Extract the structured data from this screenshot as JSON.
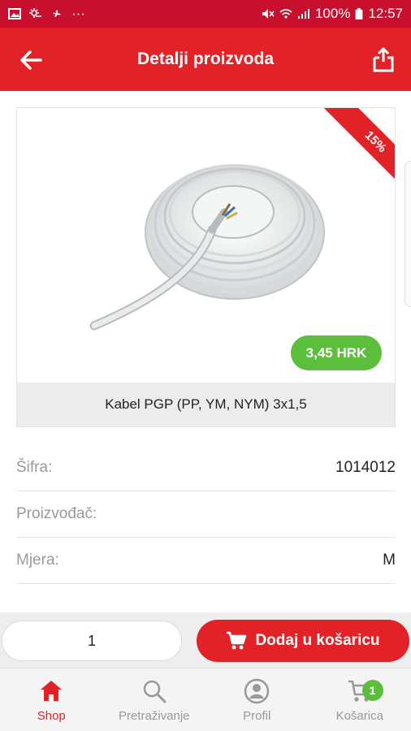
{
  "status_bar": {
    "left_icons": [
      "image-icon",
      "weather-icon",
      "fan-icon",
      "more-dots-icon"
    ],
    "more_dots": "···",
    "battery": "100%",
    "time": "12:57"
  },
  "app_bar": {
    "title": "Detalji proizvoda",
    "back_icon": "back-arrow-icon",
    "share_icon": "share-icon"
  },
  "product": {
    "name": "Kabel PGP (PP, YM, NYM) 3x1,5",
    "discount": "15%",
    "price": "3,45 HRK",
    "image": "cable-coil-image"
  },
  "details": [
    {
      "label": "Šifra:",
      "value": "1014012"
    },
    {
      "label": "Proizvođač:",
      "value": ""
    },
    {
      "label": "Mjera:",
      "value": "M"
    }
  ],
  "cart_action": {
    "quantity": "1",
    "add_label": "Dodaj u košaricu",
    "icon": "cart-icon"
  },
  "bottom_nav": {
    "items": [
      {
        "label": "Shop",
        "icon": "home-icon",
        "active": true
      },
      {
        "label": "Pretraživanje",
        "icon": "search-icon",
        "active": false
      },
      {
        "label": "Profil",
        "icon": "profile-icon",
        "active": false
      },
      {
        "label": "Košarica",
        "icon": "cart-icon",
        "active": false,
        "badge": "1"
      }
    ]
  },
  "colors": {
    "primary_red": "#e22227",
    "status_red": "#c8102e",
    "price_green": "#5cbf3c"
  }
}
